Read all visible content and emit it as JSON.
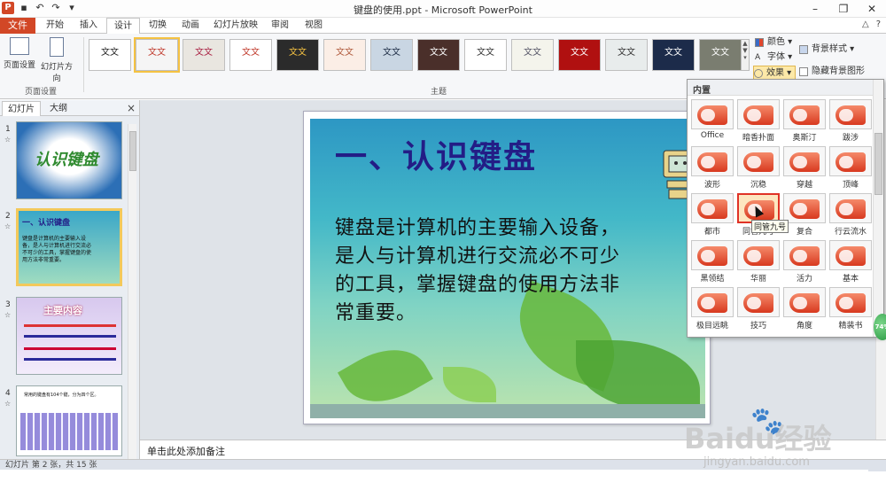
{
  "window": {
    "title": "键盘的使用.ppt - Microsoft PowerPoint",
    "logo": "P",
    "controls": [
      "–",
      "❐",
      "✕"
    ]
  },
  "tabs": {
    "file": "文件",
    "items": [
      "开始",
      "插入",
      "设计",
      "切换",
      "动画",
      "幻灯片放映",
      "审阅",
      "视图"
    ],
    "active": "设计"
  },
  "ribbon": {
    "page_setup": {
      "btn1": "页面设置",
      "btn2": "幻灯片方向",
      "group": "页面设置"
    },
    "themes": {
      "group": "主题",
      "sample_text": "文文"
    },
    "colors_label": "颜色",
    "fonts_label": "字体",
    "effects_label": "效果",
    "background_styles_label": "背景样式",
    "hide_background_label": "隐藏背景图形"
  },
  "left_panel": {
    "tab_slides": "幻灯片",
    "tab_outline": "大纲",
    "close": "×",
    "thumbs": [
      {
        "num": "1",
        "text": "认识键盘"
      },
      {
        "num": "2",
        "text": "一、认识键盘"
      },
      {
        "num": "3",
        "text": "主要内容"
      },
      {
        "num": "4",
        "text": "常用的键盘有104个键，分为四个区。"
      }
    ],
    "thumb2_body": "键盘是计算机的主要输入设备，是人与计算机进行交流必不可少的工具，掌握键盘的使用方法非常重要。"
  },
  "slide": {
    "title": "一、认识键盘",
    "body": "键盘是计算机的主要输入设备，是人与计算机进行交流必不可少的工具，掌握键盘的使用方法非常重要。"
  },
  "notes": {
    "placeholder": "单击此处添加备注"
  },
  "status": {
    "text": "幻灯片 第 2 张，共 15 张"
  },
  "effects_dropdown": {
    "header": "内置",
    "items": [
      "Office",
      "暗香扑面",
      "奥斯汀",
      "跋涉",
      "波形",
      "沉稳",
      "穿越",
      "顶峰",
      "都市",
      "同管九号",
      "复合",
      "行云流水",
      "黑领结",
      "华丽",
      "活力",
      "基本",
      "极目远眺",
      "技巧",
      "角度",
      "精装书"
    ],
    "selected_index": 9,
    "tooltip": "同管九号"
  },
  "watermark": {
    "brand": "Baidu经验",
    "url": "jingyan.baidu.com"
  },
  "colors": {
    "accent_file": "#d24726",
    "title_blue": "#231d86",
    "selection_red": "#e03226"
  }
}
